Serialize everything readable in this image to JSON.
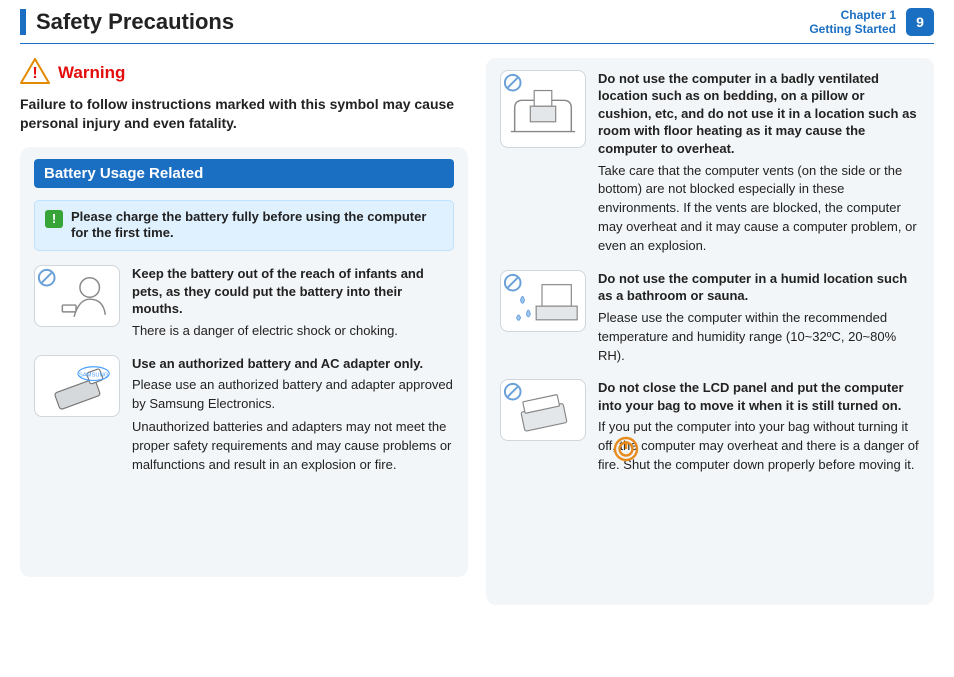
{
  "header": {
    "title": "Safety Precautions",
    "chapter_line1": "Chapter 1",
    "chapter_line2": "Getting Started",
    "page_number": "9"
  },
  "warning": {
    "label": "Warning",
    "text": "Failure to follow instructions marked with this symbol may cause personal injury and even fatality."
  },
  "section": {
    "title": "Battery Usage Related",
    "note": "Please charge the battery fully before using the computer for the first time."
  },
  "left_items": [
    {
      "bold": "Keep the battery out of the reach of infants and pets, as they could put the battery into their mouths.",
      "paras": [
        "There is a danger of electric shock or choking."
      ]
    },
    {
      "bold": "Use an authorized battery and AC adapter only.",
      "paras": [
        "Please use an authorized battery and adapter approved by Samsung Electronics.",
        "Unauthorized batteries and adapters may not meet the proper safety requirements and may cause problems or malfunctions and result in an explosion or fire."
      ]
    }
  ],
  "right_items": [
    {
      "bold": "Do not use the computer in a badly ventilated location such as on bedding, on a pillow or cushion, etc, and do not use it in a location such as room with floor heating as it may cause the computer to overheat.",
      "paras": [
        "Take care that the computer vents (on the side or the bottom) are not blocked especially in these environments. If the vents are blocked, the computer may overheat and it may cause a computer problem, or even an explosion."
      ]
    },
    {
      "bold": "Do not use the computer in a humid location such as a bathroom or sauna.",
      "paras": [
        "Please use the computer within the recommended temperature and humidity range (10~32ºC, 20~80% RH)."
      ]
    },
    {
      "bold": "Do not close the LCD panel and put the computer into your bag to move it when it is still turned on.",
      "paras": [
        "If you put the computer into your bag without turning it off, the computer may overheat and there is a danger of fire. Shut the computer down properly before moving it."
      ]
    }
  ]
}
